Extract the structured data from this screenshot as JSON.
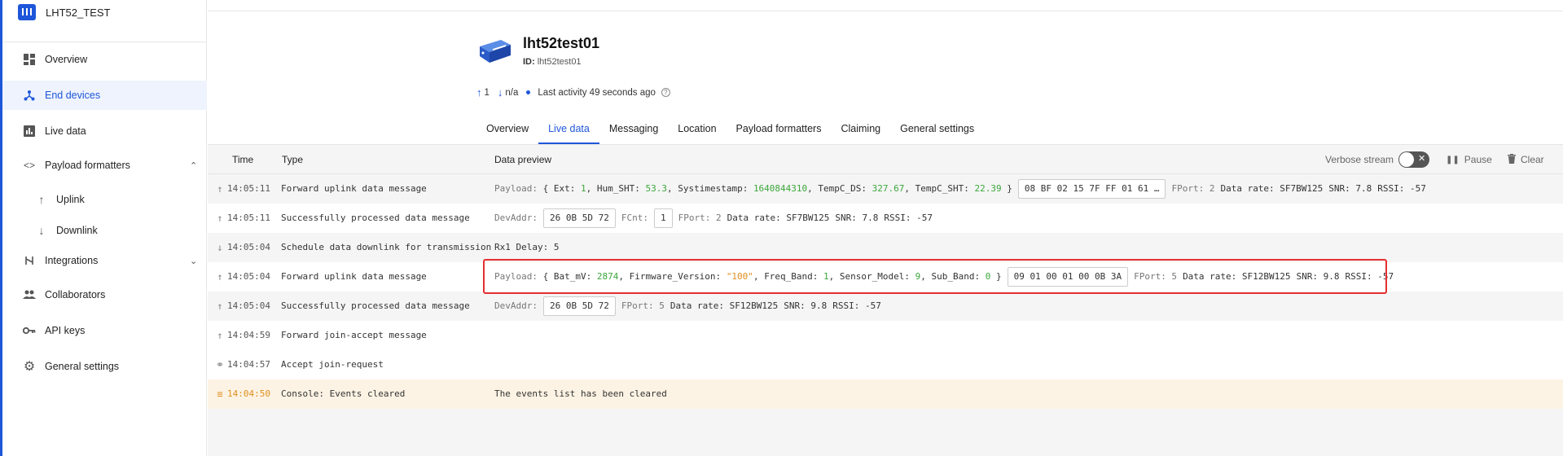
{
  "app": {
    "title": "LHT52_TEST"
  },
  "sidebar": {
    "items": [
      {
        "label": "Overview",
        "icon": "grid-icon"
      },
      {
        "label": "End devices",
        "icon": "nodes-icon",
        "active": true
      },
      {
        "label": "Live data",
        "icon": "bar-chart-icon"
      },
      {
        "label": "Payload formatters",
        "icon": "code-icon",
        "expanded": true
      },
      {
        "label": "Uplink",
        "icon": "arrow-up-icon"
      },
      {
        "label": "Downlink",
        "icon": "arrow-down-icon"
      },
      {
        "label": "Integrations",
        "icon": "integrations-icon"
      },
      {
        "label": "Collaborators",
        "icon": "people-icon"
      },
      {
        "label": "API keys",
        "icon": "key-icon"
      },
      {
        "label": "General settings",
        "icon": "gear-icon"
      }
    ]
  },
  "device": {
    "name": "lht52test01",
    "id_label": "ID:",
    "id_value": "lht52test01",
    "uplink_count": "1",
    "downlink_count": "n/a",
    "last_activity": "Last activity 49 seconds ago"
  },
  "tabs": [
    "Overview",
    "Live data",
    "Messaging",
    "Location",
    "Payload formatters",
    "Claiming",
    "General settings"
  ],
  "table": {
    "headers": {
      "time": "Time",
      "type": "Type",
      "preview": "Data preview"
    },
    "verbose_label": "Verbose stream",
    "pause_label": "Pause",
    "clear_label": "Clear"
  },
  "rows": [
    {
      "time": "14:05:11",
      "type": "Forward uplink data message",
      "payload_label": "Payload:",
      "payload_open": "{",
      "payload_close": "}",
      "fields": [
        {
          "k": "Ext:",
          "v": "1"
        },
        {
          "k": "Hum_SHT:",
          "v": "53.3"
        },
        {
          "k": "Systimestamp:",
          "v": "1640844310"
        },
        {
          "k": "TempC_DS:",
          "v": "327.67"
        },
        {
          "k": "TempC_SHT:",
          "v": "22.39"
        }
      ],
      "bytes": "08 BF 02 15 7F FF 01 61 …",
      "fport": "FPort: 2",
      "rate": "Data rate: SF7BW125",
      "snr": "SNR: 7.8",
      "rssi": "RSSI: -57"
    },
    {
      "time": "14:05:11",
      "type": "Successfully processed data message",
      "devaddr_label": "DevAddr:",
      "devaddr": "26 0B 5D 72",
      "fcnt_label": "FCnt:",
      "fcnt": "1",
      "fport": "FPort: 2",
      "rate": "Data rate: SF7BW125",
      "snr": "SNR: 7.8",
      "rssi": "RSSI: -57"
    },
    {
      "time": "14:05:04",
      "type": "Schedule data downlink for transmission",
      "preview": "Rx1 Delay: 5"
    },
    {
      "time": "14:05:04",
      "type": "Forward uplink data message",
      "payload_label": "Payload:",
      "payload_open": "{",
      "payload_close": "}",
      "f_bat_k": "Bat_mV:",
      "f_bat_v": "2874",
      "f_fw_k": "Firmware_Version:",
      "f_fw_v": "\"100\"",
      "f_freq_k": "Freq_Band:",
      "f_freq_v": "1",
      "f_model_k": "Sensor_Model:",
      "f_model_v": "9",
      "f_sub_k": "Sub_Band:",
      "f_sub_v": "0",
      "bytes": "09 01 00 01 00 0B 3A",
      "fport": "FPort: 5",
      "rate": "Data rate: SF12BW125",
      "snr": "SNR: 9.8",
      "rssi": "RSSI: -57"
    },
    {
      "time": "14:05:04",
      "type": "Successfully processed data message",
      "devaddr_label": "DevAddr:",
      "devaddr": "26 0B 5D 72",
      "fport": "FPort: 5",
      "rate": "Data rate: SF12BW125",
      "snr": "SNR: 9.8",
      "rssi": "RSSI: -57"
    },
    {
      "time": "14:04:59",
      "type": "Forward join-accept message"
    },
    {
      "time": "14:04:57",
      "type": "Accept join-request"
    },
    {
      "time": "14:04:50",
      "type": "Console: Events cleared",
      "preview": "The events list has been cleared"
    }
  ],
  "colors": {
    "accent": "#1e56d9",
    "number": "#3ca63c",
    "string": "#e09020",
    "highlight": "#e53030",
    "warning_bg": "#fdf3e4"
  }
}
